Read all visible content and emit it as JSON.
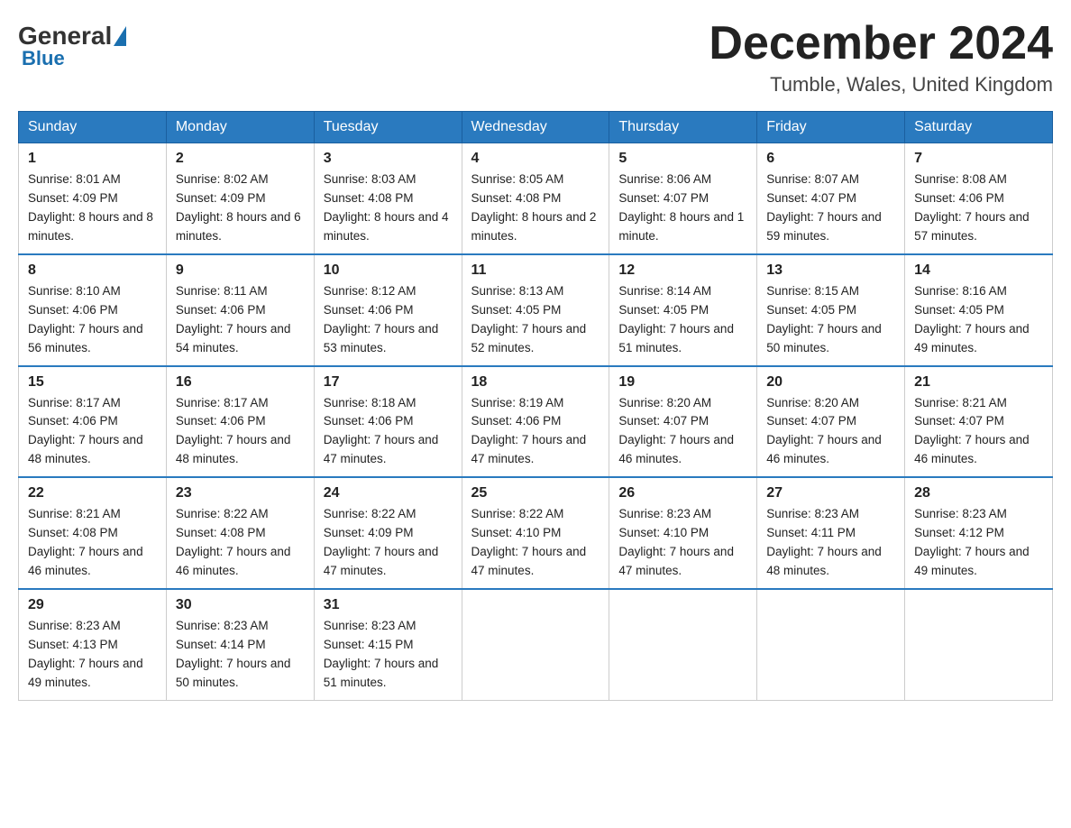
{
  "header": {
    "logo": {
      "general": "General",
      "blue": "Blue"
    },
    "title": "December 2024",
    "location": "Tumble, Wales, United Kingdom"
  },
  "weekdays": [
    "Sunday",
    "Monday",
    "Tuesday",
    "Wednesday",
    "Thursday",
    "Friday",
    "Saturday"
  ],
  "weeks": [
    [
      {
        "day": "1",
        "sunrise": "8:01 AM",
        "sunset": "4:09 PM",
        "daylight": "8 hours and 8 minutes."
      },
      {
        "day": "2",
        "sunrise": "8:02 AM",
        "sunset": "4:09 PM",
        "daylight": "8 hours and 6 minutes."
      },
      {
        "day": "3",
        "sunrise": "8:03 AM",
        "sunset": "4:08 PM",
        "daylight": "8 hours and 4 minutes."
      },
      {
        "day": "4",
        "sunrise": "8:05 AM",
        "sunset": "4:08 PM",
        "daylight": "8 hours and 2 minutes."
      },
      {
        "day": "5",
        "sunrise": "8:06 AM",
        "sunset": "4:07 PM",
        "daylight": "8 hours and 1 minute."
      },
      {
        "day": "6",
        "sunrise": "8:07 AM",
        "sunset": "4:07 PM",
        "daylight": "7 hours and 59 minutes."
      },
      {
        "day": "7",
        "sunrise": "8:08 AM",
        "sunset": "4:06 PM",
        "daylight": "7 hours and 57 minutes."
      }
    ],
    [
      {
        "day": "8",
        "sunrise": "8:10 AM",
        "sunset": "4:06 PM",
        "daylight": "7 hours and 56 minutes."
      },
      {
        "day": "9",
        "sunrise": "8:11 AM",
        "sunset": "4:06 PM",
        "daylight": "7 hours and 54 minutes."
      },
      {
        "day": "10",
        "sunrise": "8:12 AM",
        "sunset": "4:06 PM",
        "daylight": "7 hours and 53 minutes."
      },
      {
        "day": "11",
        "sunrise": "8:13 AM",
        "sunset": "4:05 PM",
        "daylight": "7 hours and 52 minutes."
      },
      {
        "day": "12",
        "sunrise": "8:14 AM",
        "sunset": "4:05 PM",
        "daylight": "7 hours and 51 minutes."
      },
      {
        "day": "13",
        "sunrise": "8:15 AM",
        "sunset": "4:05 PM",
        "daylight": "7 hours and 50 minutes."
      },
      {
        "day": "14",
        "sunrise": "8:16 AM",
        "sunset": "4:05 PM",
        "daylight": "7 hours and 49 minutes."
      }
    ],
    [
      {
        "day": "15",
        "sunrise": "8:17 AM",
        "sunset": "4:06 PM",
        "daylight": "7 hours and 48 minutes."
      },
      {
        "day": "16",
        "sunrise": "8:17 AM",
        "sunset": "4:06 PM",
        "daylight": "7 hours and 48 minutes."
      },
      {
        "day": "17",
        "sunrise": "8:18 AM",
        "sunset": "4:06 PM",
        "daylight": "7 hours and 47 minutes."
      },
      {
        "day": "18",
        "sunrise": "8:19 AM",
        "sunset": "4:06 PM",
        "daylight": "7 hours and 47 minutes."
      },
      {
        "day": "19",
        "sunrise": "8:20 AM",
        "sunset": "4:07 PM",
        "daylight": "7 hours and 46 minutes."
      },
      {
        "day": "20",
        "sunrise": "8:20 AM",
        "sunset": "4:07 PM",
        "daylight": "7 hours and 46 minutes."
      },
      {
        "day": "21",
        "sunrise": "8:21 AM",
        "sunset": "4:07 PM",
        "daylight": "7 hours and 46 minutes."
      }
    ],
    [
      {
        "day": "22",
        "sunrise": "8:21 AM",
        "sunset": "4:08 PM",
        "daylight": "7 hours and 46 minutes."
      },
      {
        "day": "23",
        "sunrise": "8:22 AM",
        "sunset": "4:08 PM",
        "daylight": "7 hours and 46 minutes."
      },
      {
        "day": "24",
        "sunrise": "8:22 AM",
        "sunset": "4:09 PM",
        "daylight": "7 hours and 47 minutes."
      },
      {
        "day": "25",
        "sunrise": "8:22 AM",
        "sunset": "4:10 PM",
        "daylight": "7 hours and 47 minutes."
      },
      {
        "day": "26",
        "sunrise": "8:23 AM",
        "sunset": "4:10 PM",
        "daylight": "7 hours and 47 minutes."
      },
      {
        "day": "27",
        "sunrise": "8:23 AM",
        "sunset": "4:11 PM",
        "daylight": "7 hours and 48 minutes."
      },
      {
        "day": "28",
        "sunrise": "8:23 AM",
        "sunset": "4:12 PM",
        "daylight": "7 hours and 49 minutes."
      }
    ],
    [
      {
        "day": "29",
        "sunrise": "8:23 AM",
        "sunset": "4:13 PM",
        "daylight": "7 hours and 49 minutes."
      },
      {
        "day": "30",
        "sunrise": "8:23 AM",
        "sunset": "4:14 PM",
        "daylight": "7 hours and 50 minutes."
      },
      {
        "day": "31",
        "sunrise": "8:23 AM",
        "sunset": "4:15 PM",
        "daylight": "7 hours and 51 minutes."
      },
      null,
      null,
      null,
      null
    ]
  ]
}
